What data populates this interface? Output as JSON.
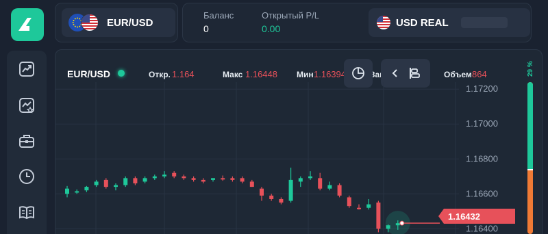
{
  "header": {
    "pair": "EUR/USD",
    "balance_label": "Баланс",
    "balance_value": "0",
    "pnl_label": "Открытый P/L",
    "pnl_value": "0.00",
    "account_label": "USD REAL"
  },
  "sidebar": {
    "items": [
      {
        "icon": "chart-up-icon"
      },
      {
        "icon": "chart-star-icon"
      },
      {
        "icon": "briefcase-icon"
      },
      {
        "icon": "clock-icon"
      },
      {
        "icon": "book-icon"
      }
    ]
  },
  "chart": {
    "symbol": "EUR/USD",
    "open_label": "Откр.",
    "open_value": "1.164",
    "high_label": "Макс",
    "high_value": "1.16448",
    "low_label": "Мин",
    "low_value": "1.16394",
    "hidden_label_fragment": "Зак",
    "volume_label": "Объем",
    "volume_value": "864",
    "current_price": "1.16432",
    "sentiment_percent": "29 %",
    "sentiment_buy_fraction": 0.29,
    "y_ticks": [
      "1.17200",
      "1.17000",
      "1.16800",
      "1.16600",
      "1.16400"
    ],
    "colors": {
      "up": "#1ec89a",
      "down": "#e7515a"
    }
  },
  "chart_data": {
    "type": "candlestick",
    "ylim": [
      1.1637,
      1.1724
    ],
    "candles": [
      {
        "o": 1.166,
        "c": 1.1663,
        "h": 1.16645,
        "l": 1.1658
      },
      {
        "o": 1.1661,
        "c": 1.16615,
        "h": 1.16625,
        "l": 1.166
      },
      {
        "o": 1.1662,
        "c": 1.1664,
        "h": 1.16645,
        "l": 1.1661
      },
      {
        "o": 1.1665,
        "c": 1.1667,
        "h": 1.1668,
        "l": 1.1664
      },
      {
        "o": 1.1668,
        "c": 1.1664,
        "h": 1.1669,
        "l": 1.1663
      },
      {
        "o": 1.1664,
        "c": 1.1665,
        "h": 1.1666,
        "l": 1.1662
      },
      {
        "o": 1.1665,
        "c": 1.1669,
        "h": 1.167,
        "l": 1.1664
      },
      {
        "o": 1.1669,
        "c": 1.1666,
        "h": 1.167,
        "l": 1.1665
      },
      {
        "o": 1.1667,
        "c": 1.1669,
        "h": 1.167,
        "l": 1.1666
      },
      {
        "o": 1.1669,
        "c": 1.167,
        "h": 1.1671,
        "l": 1.1668
      },
      {
        "o": 1.167,
        "c": 1.1671,
        "h": 1.1673,
        "l": 1.1669
      },
      {
        "o": 1.1672,
        "c": 1.167,
        "h": 1.1673,
        "l": 1.1669
      },
      {
        "o": 1.167,
        "c": 1.1669,
        "h": 1.1671,
        "l": 1.1668
      },
      {
        "o": 1.1669,
        "c": 1.1668,
        "h": 1.167,
        "l": 1.1667
      },
      {
        "o": 1.1668,
        "c": 1.1667,
        "h": 1.1669,
        "l": 1.1666
      },
      {
        "o": 1.1668,
        "c": 1.1669,
        "h": 1.1669,
        "l": 1.1667
      },
      {
        "o": 1.1669,
        "c": 1.16685,
        "h": 1.16705,
        "l": 1.16675
      },
      {
        "o": 1.1669,
        "c": 1.1668,
        "h": 1.167,
        "l": 1.1667
      },
      {
        "o": 1.1669,
        "c": 1.1667,
        "h": 1.167,
        "l": 1.1666
      },
      {
        "o": 1.1667,
        "c": 1.1664,
        "h": 1.1668,
        "l": 1.1664
      },
      {
        "o": 1.1663,
        "c": 1.1659,
        "h": 1.1664,
        "l": 1.1656
      },
      {
        "o": 1.1659,
        "c": 1.1657,
        "h": 1.166,
        "l": 1.1656
      },
      {
        "o": 1.1657,
        "c": 1.1655,
        "h": 1.1658,
        "l": 1.1654
      },
      {
        "o": 1.1656,
        "c": 1.1668,
        "h": 1.1675,
        "l": 1.1655
      },
      {
        "o": 1.1667,
        "c": 1.1669,
        "h": 1.167,
        "l": 1.1664
      },
      {
        "o": 1.1669,
        "c": 1.167,
        "h": 1.1673,
        "l": 1.1668
      },
      {
        "o": 1.1669,
        "c": 1.1663,
        "h": 1.1672,
        "l": 1.1662
      },
      {
        "o": 1.1663,
        "c": 1.1665,
        "h": 1.1667,
        "l": 1.1662
      },
      {
        "o": 1.1665,
        "c": 1.1659,
        "h": 1.1666,
        "l": 1.1658
      },
      {
        "o": 1.1658,
        "c": 1.1653,
        "h": 1.1659,
        "l": 1.1652
      },
      {
        "o": 1.1652,
        "c": 1.16515,
        "h": 1.1654,
        "l": 1.1651
      },
      {
        "o": 1.1652,
        "c": 1.1654,
        "h": 1.1657,
        "l": 1.1651
      },
      {
        "o": 1.1655,
        "c": 1.164,
        "h": 1.1656,
        "l": 1.1638
      },
      {
        "o": 1.164,
        "c": 1.1642,
        "h": 1.16425,
        "l": 1.1638
      },
      {
        "o": 1.1642,
        "c": 1.16432,
        "h": 1.16448,
        "l": 1.16394
      }
    ]
  }
}
